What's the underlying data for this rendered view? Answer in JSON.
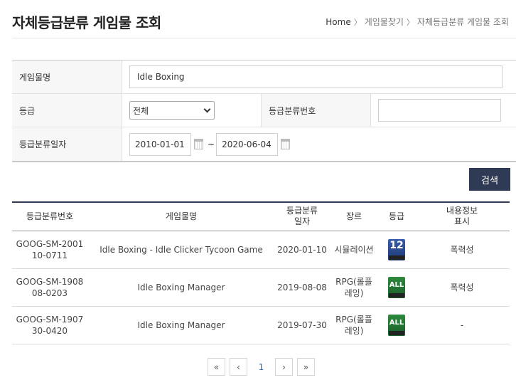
{
  "page": {
    "title": "자체등급분류 게임물 조회",
    "breadcrumb": [
      "Home",
      "게임물찾기",
      "자체등급분류 게임물 조회"
    ]
  },
  "search": {
    "game_name_label": "게임물명",
    "game_name_value": "Idle Boxing",
    "grade_label": "등급",
    "grade_selected": "전체",
    "class_no_label": "등급분류번호",
    "class_no_value": "",
    "date_label": "등급분류일자",
    "date_from": "2010-01-01",
    "date_sep": "~",
    "date_to": "2020-06-04",
    "button_label": "검색"
  },
  "table": {
    "headers": [
      "등급분류번호",
      "게임물명",
      "등급분류\n일자",
      "장르",
      "등급",
      "내용정보\n표시"
    ],
    "rows": [
      {
        "no": "GOOG-SM-2001\n10-0711",
        "name": "Idle Boxing - Idle Clicker Tycoon Game",
        "date": "2020-01-10",
        "genre": "시뮬레이션",
        "rating": "12",
        "rating_icon": "rating-12-icon",
        "content": "폭력성"
      },
      {
        "no": "GOOG-SM-1908\n08-0203",
        "name": "Idle Boxing Manager",
        "date": "2019-08-08",
        "genre": "RPG(롤플\n레잉)",
        "rating": "ALL",
        "rating_icon": "rating-all-icon",
        "content": "폭력성"
      },
      {
        "no": "GOOG-SM-1907\n30-0420",
        "name": "Idle Boxing Manager",
        "date": "2019-07-30",
        "genre": "RPG(롤플\n레잉)",
        "rating": "ALL",
        "rating_icon": "rating-all-icon",
        "content": "-"
      }
    ]
  },
  "pager": {
    "first": "«",
    "prev": "‹",
    "current": "1",
    "next": "›",
    "last": "»"
  },
  "colors": {
    "accent": "#2f3a55",
    "page_link": "#2c66b8"
  }
}
